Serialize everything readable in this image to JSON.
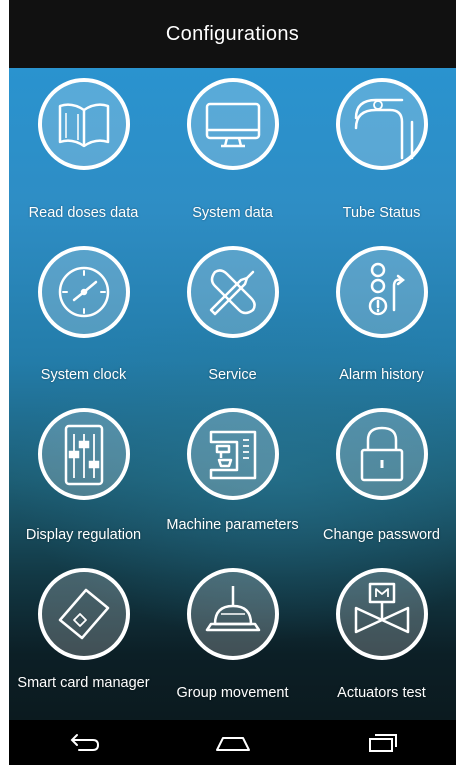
{
  "header": {
    "title": "Configurations"
  },
  "menu": {
    "items": [
      {
        "label": "Read doses data",
        "icon": "book-icon"
      },
      {
        "label": "System data",
        "icon": "monitor-icon"
      },
      {
        "label": "Tube Status",
        "icon": "tube-icon"
      },
      {
        "label": "System clock",
        "icon": "clock-icon"
      },
      {
        "label": "Service",
        "icon": "wrench-screwdriver-icon"
      },
      {
        "label": "Alarm history",
        "icon": "alarm-history-icon"
      },
      {
        "label": "Display regulation",
        "icon": "sliders-icon"
      },
      {
        "label": "Machine parameters",
        "icon": "coffee-machine-icon"
      },
      {
        "label": "Change password",
        "icon": "padlock-icon"
      },
      {
        "label": "Smart card manager",
        "icon": "smart-card-icon"
      },
      {
        "label": "Group movement",
        "icon": "group-head-icon"
      },
      {
        "label": "Actuators test",
        "icon": "valve-icon"
      }
    ]
  },
  "navbar": {
    "back": "back-icon",
    "home": "home-icon",
    "recents": "recents-icon"
  },
  "colors": {
    "top_background": "#2a93cf",
    "bottom_background": "#0b1a1f",
    "icon_ring": "#ffffff"
  }
}
